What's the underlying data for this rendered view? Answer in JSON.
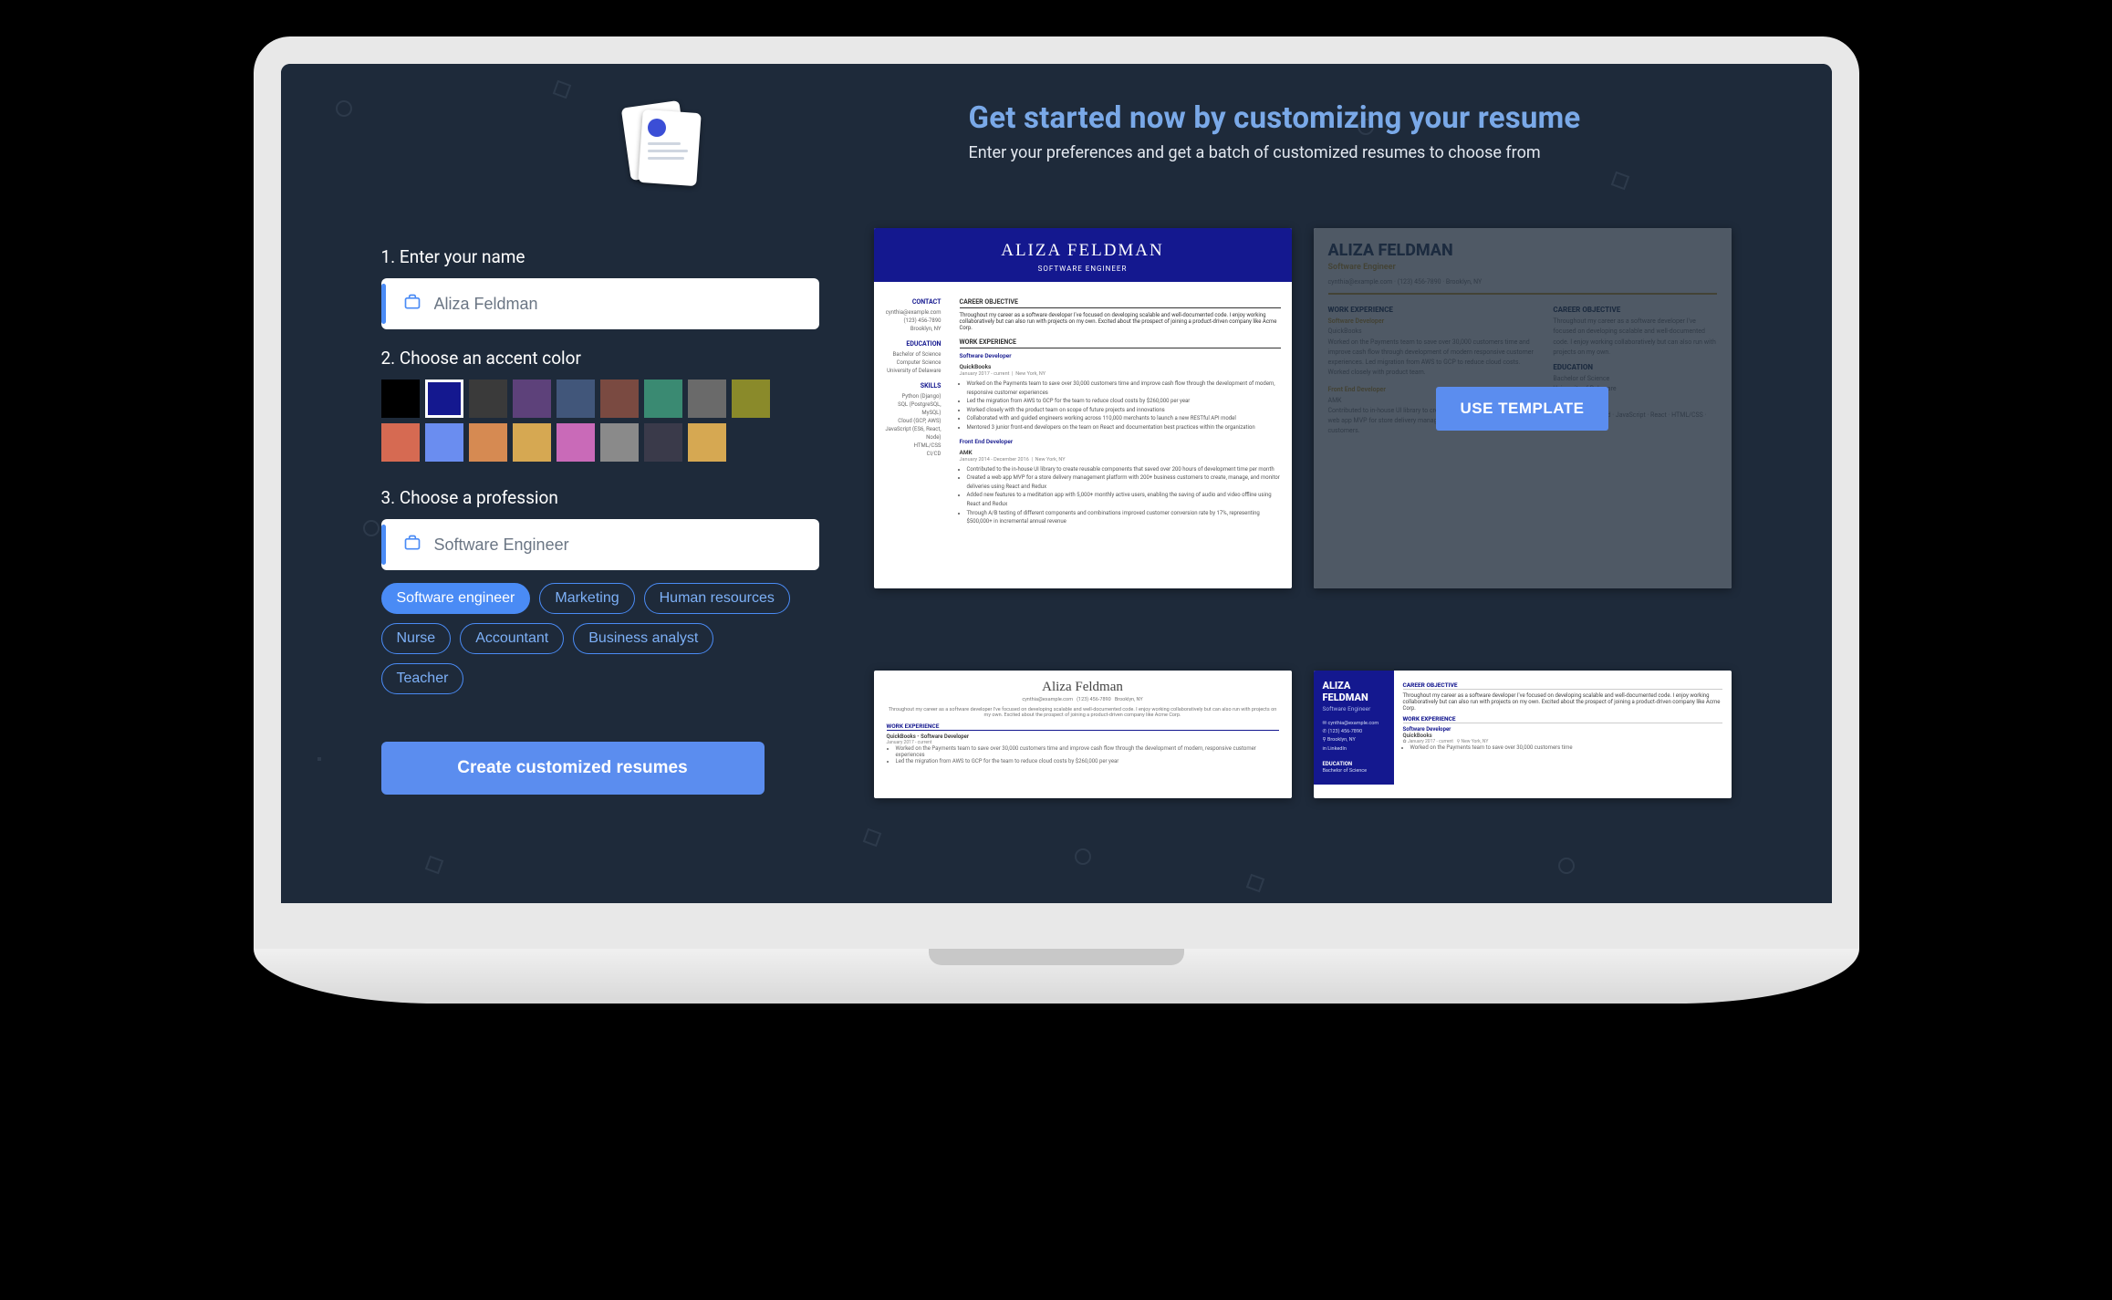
{
  "header": {
    "title": "Get started now by customizing your resume",
    "subtitle": "Enter your preferences and get a batch of customized resumes to choose from"
  },
  "step1": {
    "label": "1.  Enter your name",
    "value": "Aliza Feldman"
  },
  "step2": {
    "label": "2. Choose an accent color",
    "colors": [
      "#000000",
      "#14188f",
      "#3a3a3a",
      "#5d417a",
      "#41567a",
      "#7a4a41",
      "#3a8a72",
      "#6a6a6a",
      "#8a8a2a",
      "#d66a52",
      "#6a8df0",
      "#d68a52",
      "#d6a852",
      "#c96ab8",
      "#8a8a8a",
      "#3a3a4a",
      "#d6a852"
    ],
    "selected_index": 1
  },
  "step3": {
    "label": "3. Choose a profession",
    "value": "Software Engineer",
    "chips": [
      "Software engineer",
      "Marketing",
      "Human resources",
      "Nurse",
      "Accountant",
      "Business analyst",
      "Teacher"
    ],
    "active_chip_index": 0
  },
  "cta_label": "Create customized resumes",
  "use_template_label": "USE TEMPLATE",
  "preview": {
    "name": "Aliza Feldman",
    "name_upper": "ALIZA FELDMAN",
    "role": "SOFTWARE ENGINEER",
    "role_title": "Software Engineer",
    "sections": {
      "contact": "CONTACT",
      "education": "EDUCATION",
      "skills": "SKILLS",
      "objective": "CAREER OBJECTIVE",
      "work": "WORK EXPERIENCE"
    },
    "job1_title": "Software Developer",
    "job1_company": "QuickBooks",
    "job1_dates": "January 2017 - current",
    "job1_loc": "New York, NY",
    "job2_title": "Front End Developer",
    "job2_company": "AMK",
    "job2_dates": "January 2014 - December 2016",
    "degree": "Bachelor of Science",
    "major": "Computer Science",
    "school": "University of Delaware",
    "contact_email": "cynthia@example.com",
    "contact_phone": "(123) 456-7890",
    "contact_city": "Brooklyn, NY",
    "contact_linkedin": "LinkedIn"
  }
}
